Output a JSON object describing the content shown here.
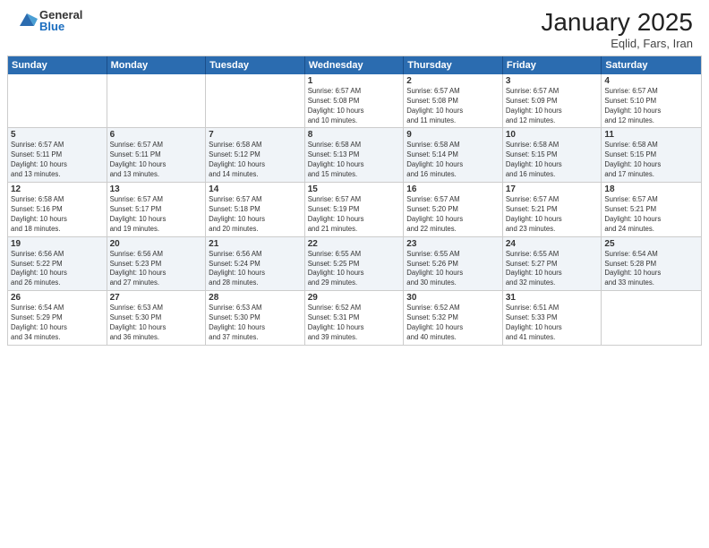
{
  "header": {
    "logo_general": "General",
    "logo_blue": "Blue",
    "title": "January 2025",
    "subtitle": "Eqlid, Fars, Iran"
  },
  "calendar": {
    "weekdays": [
      "Sunday",
      "Monday",
      "Tuesday",
      "Wednesday",
      "Thursday",
      "Friday",
      "Saturday"
    ],
    "weeks": [
      [
        {
          "day": "",
          "info": ""
        },
        {
          "day": "",
          "info": ""
        },
        {
          "day": "",
          "info": ""
        },
        {
          "day": "1",
          "info": "Sunrise: 6:57 AM\nSunset: 5:08 PM\nDaylight: 10 hours\nand 10 minutes."
        },
        {
          "day": "2",
          "info": "Sunrise: 6:57 AM\nSunset: 5:08 PM\nDaylight: 10 hours\nand 11 minutes."
        },
        {
          "day": "3",
          "info": "Sunrise: 6:57 AM\nSunset: 5:09 PM\nDaylight: 10 hours\nand 12 minutes."
        },
        {
          "day": "4",
          "info": "Sunrise: 6:57 AM\nSunset: 5:10 PM\nDaylight: 10 hours\nand 12 minutes."
        }
      ],
      [
        {
          "day": "5",
          "info": "Sunrise: 6:57 AM\nSunset: 5:11 PM\nDaylight: 10 hours\nand 13 minutes."
        },
        {
          "day": "6",
          "info": "Sunrise: 6:57 AM\nSunset: 5:11 PM\nDaylight: 10 hours\nand 13 minutes."
        },
        {
          "day": "7",
          "info": "Sunrise: 6:58 AM\nSunset: 5:12 PM\nDaylight: 10 hours\nand 14 minutes."
        },
        {
          "day": "8",
          "info": "Sunrise: 6:58 AM\nSunset: 5:13 PM\nDaylight: 10 hours\nand 15 minutes."
        },
        {
          "day": "9",
          "info": "Sunrise: 6:58 AM\nSunset: 5:14 PM\nDaylight: 10 hours\nand 16 minutes."
        },
        {
          "day": "10",
          "info": "Sunrise: 6:58 AM\nSunset: 5:15 PM\nDaylight: 10 hours\nand 16 minutes."
        },
        {
          "day": "11",
          "info": "Sunrise: 6:58 AM\nSunset: 5:15 PM\nDaylight: 10 hours\nand 17 minutes."
        }
      ],
      [
        {
          "day": "12",
          "info": "Sunrise: 6:58 AM\nSunset: 5:16 PM\nDaylight: 10 hours\nand 18 minutes."
        },
        {
          "day": "13",
          "info": "Sunrise: 6:57 AM\nSunset: 5:17 PM\nDaylight: 10 hours\nand 19 minutes."
        },
        {
          "day": "14",
          "info": "Sunrise: 6:57 AM\nSunset: 5:18 PM\nDaylight: 10 hours\nand 20 minutes."
        },
        {
          "day": "15",
          "info": "Sunrise: 6:57 AM\nSunset: 5:19 PM\nDaylight: 10 hours\nand 21 minutes."
        },
        {
          "day": "16",
          "info": "Sunrise: 6:57 AM\nSunset: 5:20 PM\nDaylight: 10 hours\nand 22 minutes."
        },
        {
          "day": "17",
          "info": "Sunrise: 6:57 AM\nSunset: 5:21 PM\nDaylight: 10 hours\nand 23 minutes."
        },
        {
          "day": "18",
          "info": "Sunrise: 6:57 AM\nSunset: 5:21 PM\nDaylight: 10 hours\nand 24 minutes."
        }
      ],
      [
        {
          "day": "19",
          "info": "Sunrise: 6:56 AM\nSunset: 5:22 PM\nDaylight: 10 hours\nand 26 minutes."
        },
        {
          "day": "20",
          "info": "Sunrise: 6:56 AM\nSunset: 5:23 PM\nDaylight: 10 hours\nand 27 minutes."
        },
        {
          "day": "21",
          "info": "Sunrise: 6:56 AM\nSunset: 5:24 PM\nDaylight: 10 hours\nand 28 minutes."
        },
        {
          "day": "22",
          "info": "Sunrise: 6:55 AM\nSunset: 5:25 PM\nDaylight: 10 hours\nand 29 minutes."
        },
        {
          "day": "23",
          "info": "Sunrise: 6:55 AM\nSunset: 5:26 PM\nDaylight: 10 hours\nand 30 minutes."
        },
        {
          "day": "24",
          "info": "Sunrise: 6:55 AM\nSunset: 5:27 PM\nDaylight: 10 hours\nand 32 minutes."
        },
        {
          "day": "25",
          "info": "Sunrise: 6:54 AM\nSunset: 5:28 PM\nDaylight: 10 hours\nand 33 minutes."
        }
      ],
      [
        {
          "day": "26",
          "info": "Sunrise: 6:54 AM\nSunset: 5:29 PM\nDaylight: 10 hours\nand 34 minutes."
        },
        {
          "day": "27",
          "info": "Sunrise: 6:53 AM\nSunset: 5:30 PM\nDaylight: 10 hours\nand 36 minutes."
        },
        {
          "day": "28",
          "info": "Sunrise: 6:53 AM\nSunset: 5:30 PM\nDaylight: 10 hours\nand 37 minutes."
        },
        {
          "day": "29",
          "info": "Sunrise: 6:52 AM\nSunset: 5:31 PM\nDaylight: 10 hours\nand 39 minutes."
        },
        {
          "day": "30",
          "info": "Sunrise: 6:52 AM\nSunset: 5:32 PM\nDaylight: 10 hours\nand 40 minutes."
        },
        {
          "day": "31",
          "info": "Sunrise: 6:51 AM\nSunset: 5:33 PM\nDaylight: 10 hours\nand 41 minutes."
        },
        {
          "day": "",
          "info": ""
        }
      ]
    ]
  }
}
